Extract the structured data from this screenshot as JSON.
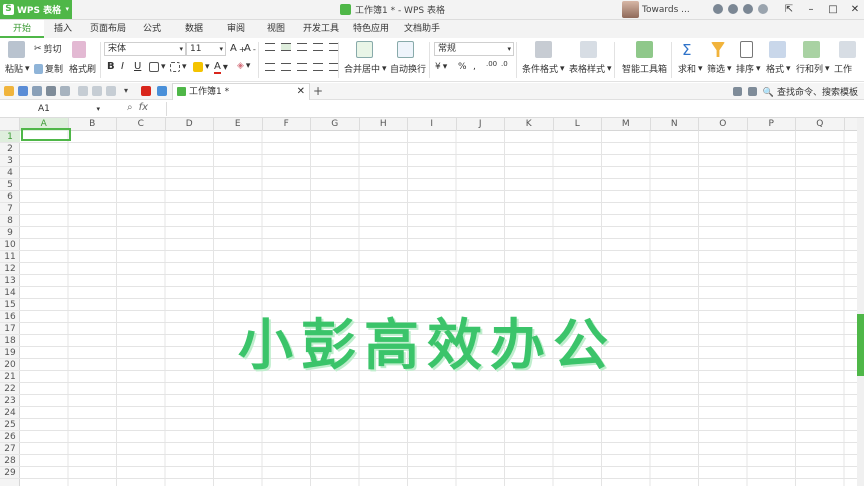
{
  "app": {
    "name": "WPS 表格",
    "title": "工作簿1 * - WPS 表格",
    "user": "Towards ..."
  },
  "tabs": [
    "开始",
    "插入",
    "页面布局",
    "公式",
    "数据",
    "审阅",
    "视图",
    "开发工具",
    "特色应用",
    "文档助手"
  ],
  "ribbon": {
    "paste": "粘贴",
    "cut": "剪切",
    "copy": "复制",
    "format_painter": "格式刷",
    "font": "宋体",
    "font_size": "11",
    "merge_center": "合并居中",
    "wrap": "自动换行",
    "number_format": "常规",
    "percent": "%",
    "cond_format": "条件格式",
    "table_style": "表格样式",
    "smart_toolbox": "智能工具箱",
    "sum": "求和",
    "filter": "筛选",
    "sort": "排序",
    "format": "格式",
    "rowcol": "行和列",
    "worksheet": "工作"
  },
  "quickbar": {
    "doc_tab": "工作簿1 *",
    "search": "查找命令、搜索模板"
  },
  "formula": {
    "cell_ref": "A1",
    "fx": "fx",
    "value": ""
  },
  "sheet": {
    "columns": [
      "A",
      "B",
      "C",
      "D",
      "E",
      "F",
      "G",
      "H",
      "I",
      "J",
      "K",
      "L",
      "M",
      "N",
      "O",
      "P",
      "Q"
    ],
    "rows": [
      "1",
      "2",
      "3",
      "4",
      "5",
      "6",
      "7",
      "8",
      "9",
      "10",
      "11",
      "12",
      "13",
      "14",
      "15",
      "16",
      "17",
      "18",
      "19",
      "20",
      "21",
      "22",
      "23",
      "24",
      "25",
      "26",
      "27",
      "28",
      "29"
    ]
  },
  "watermark": "小彭高效办公",
  "colors": {
    "accent": "#4fb748",
    "watermark": "#3bc46a"
  }
}
